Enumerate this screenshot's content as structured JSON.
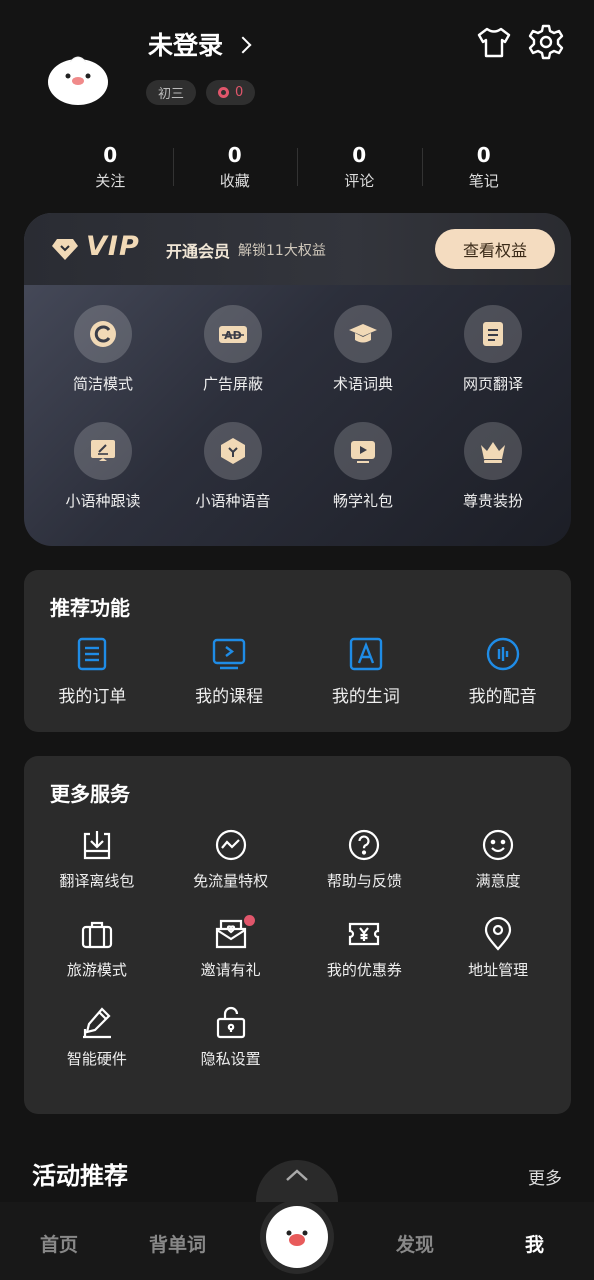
{
  "profile": {
    "name": "未登录",
    "grade": "初三",
    "points": "0"
  },
  "stats": [
    {
      "num": "0",
      "label": "关注"
    },
    {
      "num": "0",
      "label": "收藏"
    },
    {
      "num": "0",
      "label": "评论"
    },
    {
      "num": "0",
      "label": "笔记"
    }
  ],
  "vip": {
    "badge": "VIP",
    "open": "开通会员",
    "unlock": "解锁11大权益",
    "button": "查看权益",
    "items": [
      {
        "label": "简洁模式",
        "icon": "simple-mode-icon"
      },
      {
        "label": "广告屏蔽",
        "icon": "ad-block-icon"
      },
      {
        "label": "术语词典",
        "icon": "graduation-cap-icon"
      },
      {
        "label": "网页翻译",
        "icon": "web-translate-icon"
      },
      {
        "label": "小语种跟读",
        "icon": "read-along-icon"
      },
      {
        "label": "小语种语音",
        "icon": "voice-icon"
      },
      {
        "label": "畅学礼包",
        "icon": "video-gift-icon"
      },
      {
        "label": "尊贵装扮",
        "icon": "crown-icon"
      }
    ]
  },
  "recommend": {
    "title": "推荐功能",
    "items": [
      {
        "label": "我的订单",
        "icon": "order-icon"
      },
      {
        "label": "我的课程",
        "icon": "course-icon"
      },
      {
        "label": "我的生词",
        "icon": "vocabulary-icon"
      },
      {
        "label": "我的配音",
        "icon": "dubbing-icon"
      }
    ]
  },
  "services": {
    "title": "更多服务",
    "items": [
      {
        "label": "翻译离线包",
        "icon": "download-icon"
      },
      {
        "label": "免流量特权",
        "icon": "data-free-icon"
      },
      {
        "label": "帮助与反馈",
        "icon": "help-icon"
      },
      {
        "label": "满意度",
        "icon": "smile-icon"
      },
      {
        "label": "旅游模式",
        "icon": "suitcase-icon"
      },
      {
        "label": "邀请有礼",
        "icon": "invite-icon"
      },
      {
        "label": "我的优惠券",
        "icon": "coupon-icon"
      },
      {
        "label": "地址管理",
        "icon": "location-icon"
      },
      {
        "label": "智能硬件",
        "icon": "smart-pen-icon"
      },
      {
        "label": "隐私设置",
        "icon": "privacy-lock-icon"
      }
    ]
  },
  "activity": {
    "title": "活动推荐",
    "more": "更多"
  },
  "nav": {
    "home": "首页",
    "words": "背单词",
    "discover": "发现",
    "me": "我"
  },
  "colors": {
    "accent": "#1f8ce6",
    "vip_gold": "#f1d9b6",
    "badge_red": "#e0566b",
    "background": "#141414",
    "card": "#2b2b2b"
  }
}
